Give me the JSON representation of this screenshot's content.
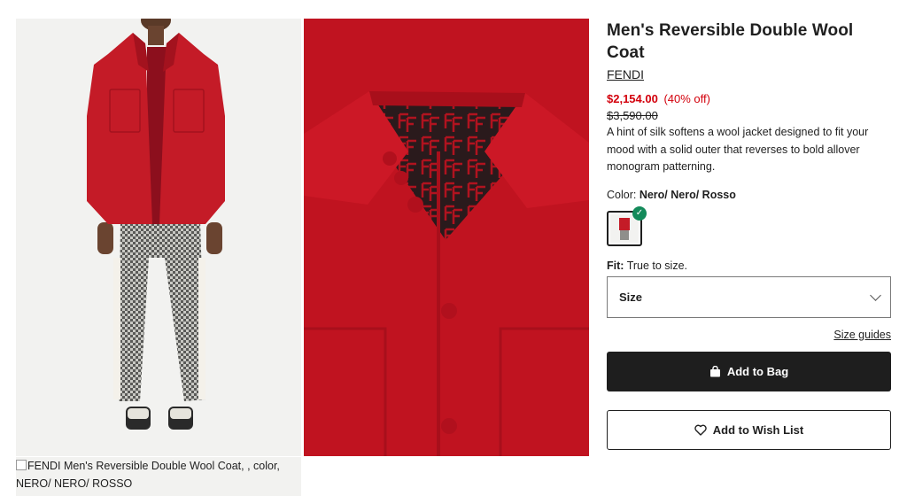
{
  "product": {
    "title": "Men's Reversible Double Wool Coat",
    "brand": "FENDI",
    "price": "$2,154.00",
    "discount": "(40% off)",
    "original_price": "$3,590.00",
    "description": "A hint of silk softens a wool jacket designed to fit your mood with a solid outer that reverses to bold allover monogram patterning."
  },
  "color": {
    "label": "Color:",
    "value": "Nero/ Nero/ Rosso",
    "swatch_icon": "check-icon"
  },
  "fit": {
    "label": "Fit:",
    "value": "True to size."
  },
  "size": {
    "label": "Size",
    "guides": "Size guides"
  },
  "actions": {
    "add_to_bag": "Add to Bag",
    "add_to_wish_list": "Add to Wish List"
  },
  "gallery": {
    "broken_alt": "FENDI Men's Reversible Double Wool Coat, , color, NERO/ NERO/ ROSSO"
  },
  "colors": {
    "price_red": "#d3000c",
    "button_dark": "#1e1e1e",
    "check_green": "#138a5a",
    "coat_red": "#bf1220"
  }
}
